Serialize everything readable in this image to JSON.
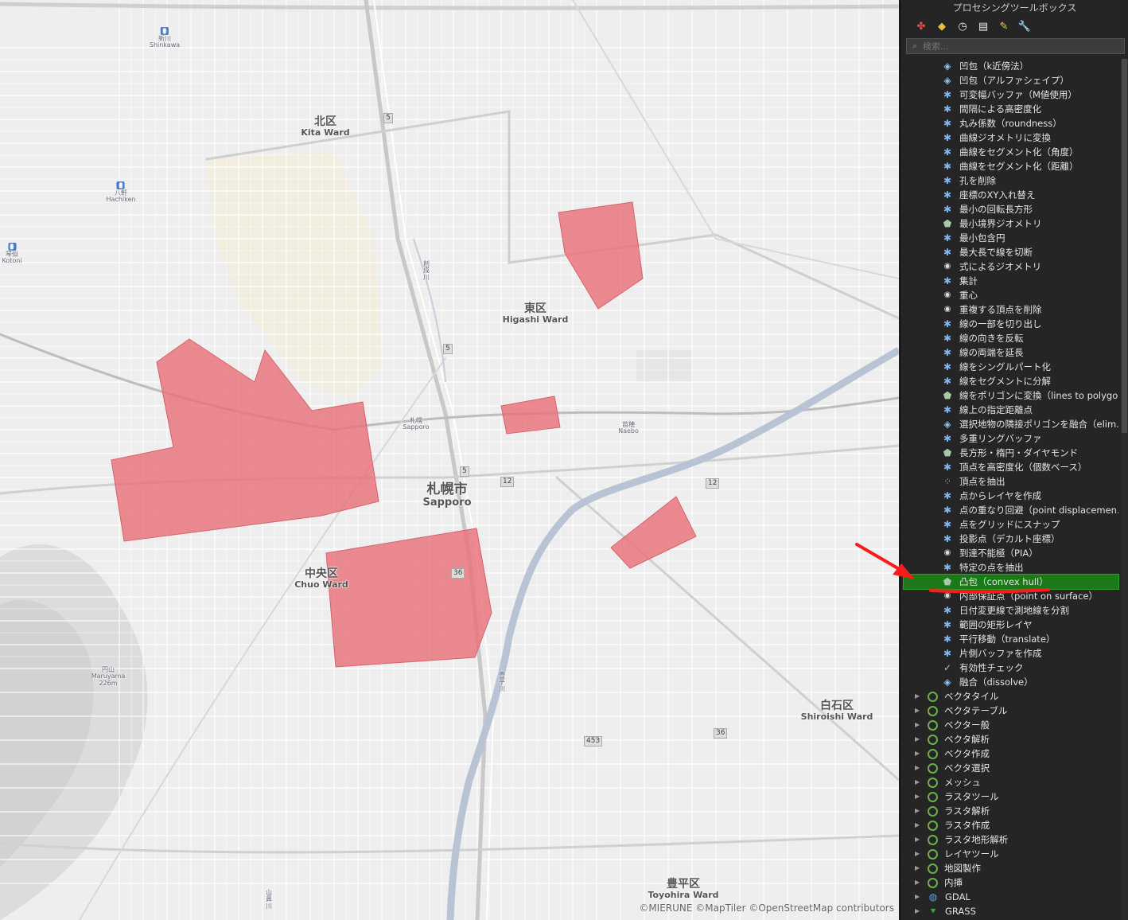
{
  "map": {
    "labels": {
      "kita_jp": "北区",
      "kita_en": "Kita Ward",
      "higashi_jp": "東区",
      "higashi_en": "Higashi Ward",
      "chuo_jp": "中央区",
      "chuo_en": "Chuo Ward",
      "sapporo_jp": "札幌市",
      "sapporo_en": "Sapporo",
      "shiroishi_jp": "白石区",
      "shiroishi_en": "Shiroishi Ward",
      "toyohira_jp": "豊平区",
      "toyohira_en": "Toyohira Ward",
      "shinkawa_jp": "新川",
      "shinkawa_en": "Shinkawa",
      "hachiken_jp": "八軒",
      "hachiken_en": "Hachiken",
      "kotoni_jp": "琴似",
      "kotoni_en": "Kotoni",
      "sapporo_st_jp": "札幌",
      "sapporo_st_en": "Sapporo",
      "naebo_jp": "苗穂",
      "naebo_en": "Naebo",
      "maruyama_jp": "円山",
      "maruyama_en": "Maruyama",
      "maruyama_elev": "226m",
      "sosei_river": "創成川",
      "toyohira_river": "豊平川",
      "yamahana_river": "山鼻川"
    },
    "route_shields": [
      "5",
      "5",
      "5",
      "12",
      "12",
      "36",
      "36",
      "453"
    ],
    "attribution": "©MIERUNE ©MapTiler ©OpenStreetMap contributors",
    "colors": {
      "hull_fill": "#e8737a",
      "background": "#eeeeee",
      "road": "#ffffff",
      "park": "#f1eee0"
    }
  },
  "panel": {
    "title": "プロセシングツールボックス",
    "toolbar_icons": [
      "models-icon",
      "python-icon",
      "history-icon",
      "results-icon",
      "edit-features-icon",
      "options-icon"
    ],
    "search_placeholder": "検索...",
    "algorithms": [
      {
        "label": "凹包（k近傍法）",
        "icon": "blob"
      },
      {
        "label": "凹包（アルファシェイプ）",
        "icon": "blob"
      },
      {
        "label": "可変幅バッファ（M値使用）",
        "icon": "gear"
      },
      {
        "label": "間隔による高密度化",
        "icon": "gear"
      },
      {
        "label": "丸み係数（roundness）",
        "icon": "gear"
      },
      {
        "label": "曲線ジオメトリに変換",
        "icon": "gear"
      },
      {
        "label": "曲線をセグメント化（角度）",
        "icon": "gear"
      },
      {
        "label": "曲線をセグメント化（距離）",
        "icon": "gear"
      },
      {
        "label": "孔を削除",
        "icon": "gear"
      },
      {
        "label": "座標のXY入れ替え",
        "icon": "gear"
      },
      {
        "label": "最小の回転長方形",
        "icon": "gear"
      },
      {
        "label": "最小境界ジオメトリ",
        "icon": "poly"
      },
      {
        "label": "最小包含円",
        "icon": "gear"
      },
      {
        "label": "最大長で線を切断",
        "icon": "gear"
      },
      {
        "label": "式によるジオメトリ",
        "icon": "eye"
      },
      {
        "label": "集計",
        "icon": "gear"
      },
      {
        "label": "重心",
        "icon": "eye"
      },
      {
        "label": "重複する頂点を削除",
        "icon": "eye"
      },
      {
        "label": "線の一部を切り出し",
        "icon": "gear"
      },
      {
        "label": "線の向きを反転",
        "icon": "gear"
      },
      {
        "label": "線の両端を延長",
        "icon": "gear"
      },
      {
        "label": "線をシングルパート化",
        "icon": "gear"
      },
      {
        "label": "線をセグメントに分解",
        "icon": "gear"
      },
      {
        "label": "線をポリゴンに変換（lines to polygo...",
        "icon": "poly"
      },
      {
        "label": "線上の指定距離点",
        "icon": "gear"
      },
      {
        "label": "選択地物の隣接ポリゴンを融合（elim...",
        "icon": "blob"
      },
      {
        "label": "多重リングバッファ",
        "icon": "gear"
      },
      {
        "label": "長方形・楕円・ダイヤモンド",
        "icon": "poly"
      },
      {
        "label": "頂点を高密度化（個数ベース）",
        "icon": "gear"
      },
      {
        "label": "頂点を抽出",
        "icon": "dots"
      },
      {
        "label": "点からレイヤを作成",
        "icon": "gear"
      },
      {
        "label": "点の重なり回避（point displacemen...",
        "icon": "gear"
      },
      {
        "label": "点をグリッドにスナップ",
        "icon": "gear"
      },
      {
        "label": "投影点（デカルト座標）",
        "icon": "gear"
      },
      {
        "label": "到達不能極（PIA）",
        "icon": "eye"
      },
      {
        "label": "特定の点を抽出",
        "icon": "gear"
      },
      {
        "label": "凸包（convex hull）",
        "icon": "poly",
        "selected": true
      },
      {
        "label": "内部保証点（point on surface）",
        "icon": "eye"
      },
      {
        "label": "日付変更線で測地線を分割",
        "icon": "gear"
      },
      {
        "label": "範囲の矩形レイヤ",
        "icon": "gear"
      },
      {
        "label": "平行移動（translate）",
        "icon": "gear"
      },
      {
        "label": "片側バッファを作成",
        "icon": "gear"
      },
      {
        "label": "有効性チェック",
        "icon": "check"
      },
      {
        "label": "融合（dissolve）",
        "icon": "blob"
      }
    ],
    "groups": [
      {
        "label": "ベクタタイル",
        "icon": "q"
      },
      {
        "label": "ベクタテーブル",
        "icon": "q"
      },
      {
        "label": "ベクター般",
        "icon": "q"
      },
      {
        "label": "ベクタ解析",
        "icon": "q"
      },
      {
        "label": "ベクタ作成",
        "icon": "q"
      },
      {
        "label": "ベクタ選択",
        "icon": "q"
      },
      {
        "label": "メッシュ",
        "icon": "q"
      },
      {
        "label": "ラスタツール",
        "icon": "q"
      },
      {
        "label": "ラスタ解析",
        "icon": "q"
      },
      {
        "label": "ラスタ作成",
        "icon": "q"
      },
      {
        "label": "ラスタ地形解析",
        "icon": "q"
      },
      {
        "label": "レイヤツール",
        "icon": "q"
      },
      {
        "label": "地図製作",
        "icon": "q"
      },
      {
        "label": "内挿",
        "icon": "q"
      },
      {
        "label": "GDAL",
        "icon": "gdal"
      },
      {
        "label": "GRASS",
        "icon": "grass"
      }
    ],
    "colors": {
      "selected_bg": "#1a7a1a",
      "annotation": "#ff1a1a",
      "gear": "#7fb6ee"
    }
  }
}
